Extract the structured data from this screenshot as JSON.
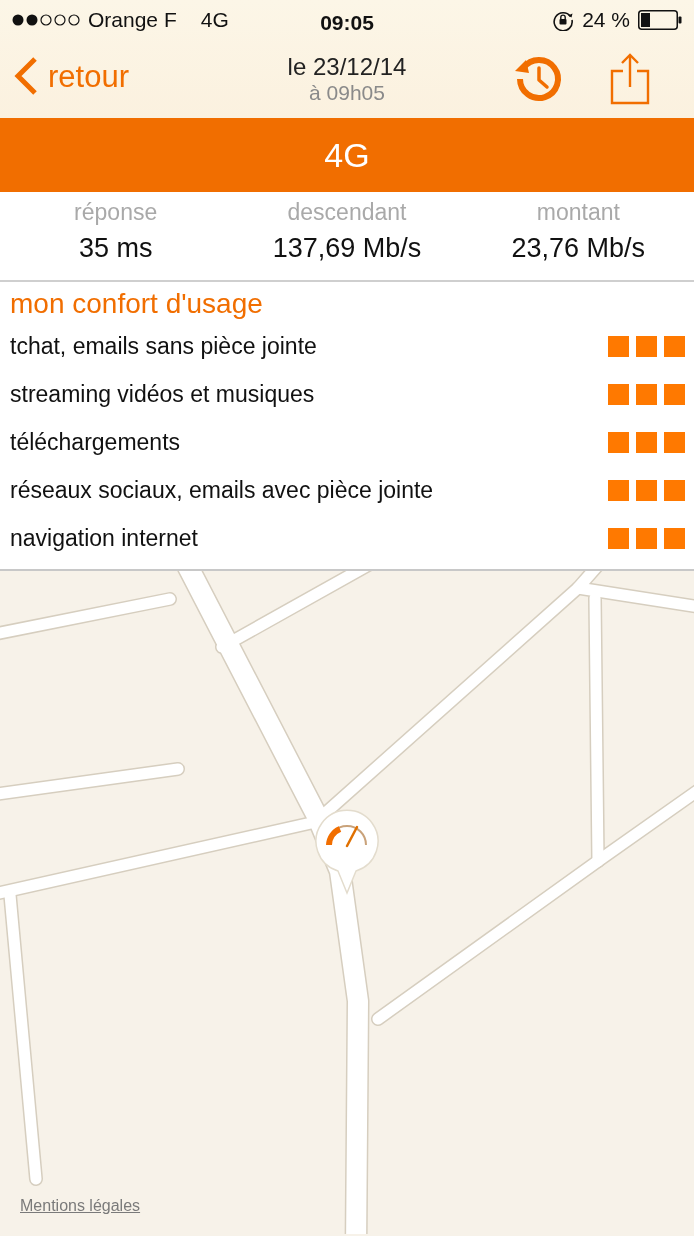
{
  "status_bar": {
    "carrier": "Orange F",
    "network": "4G",
    "time": "09:05",
    "battery": "24 %"
  },
  "nav": {
    "back": "retour",
    "date": "le 23/12/14",
    "time": "à 09h05"
  },
  "banner": {
    "title": "4G"
  },
  "stats": [
    {
      "label": "réponse",
      "value": "35 ms"
    },
    {
      "label": "descendant",
      "value": "137,69 Mb/s"
    },
    {
      "label": "montant",
      "value": "23,76 Mb/s"
    }
  ],
  "comfort": {
    "title": "mon confort d'usage",
    "items": [
      {
        "label": "tchat, emails sans pièce jointe",
        "stars": 3
      },
      {
        "label": "streaming vidéos et musiques",
        "stars": 3
      },
      {
        "label": "téléchargements",
        "stars": 3
      },
      {
        "label": "réseaux sociaux, emails avec pièce jointe",
        "stars": 3
      },
      {
        "label": "navigation internet",
        "stars": 3
      }
    ]
  },
  "map": {
    "legal_link": "Mentions légales"
  }
}
